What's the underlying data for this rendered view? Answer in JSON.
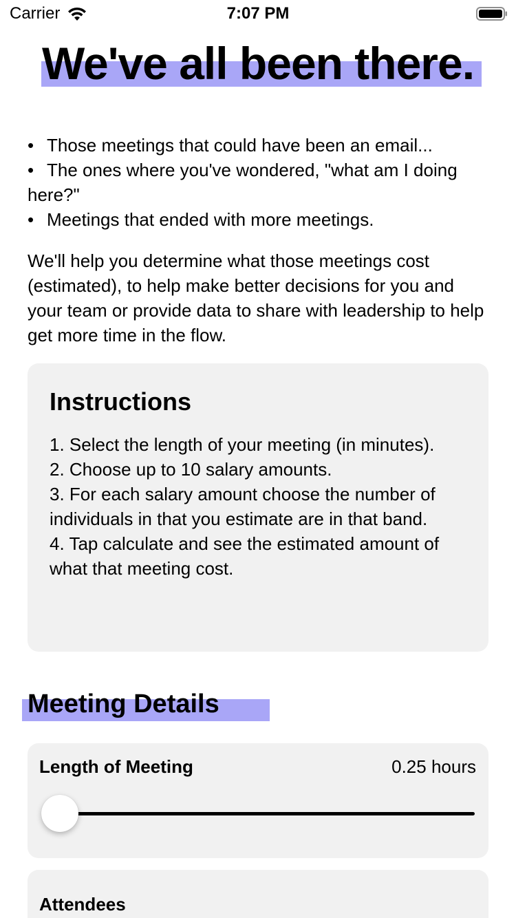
{
  "status_bar": {
    "carrier": "Carrier",
    "time": "7:07 PM",
    "icons": [
      "wifi-icon",
      "battery-icon"
    ]
  },
  "hero": {
    "title": "We've all been there.",
    "highlight_color": "#a9a6f7"
  },
  "bullets": [
    "Those meetings that could have been an email...",
    "The ones where you've wondered, \"what am I doing here?\"",
    "Meetings that ended with more meetings."
  ],
  "intro": "We'll help you determine what those meetings cost (estimated), to help make better decisions for you and your team or provide data to share with leadership to help get more time in the flow.",
  "instructions": {
    "title": "Instructions",
    "steps": [
      "1. Select the length of your meeting (in minutes).",
      "2. Choose up to 10 salary amounts.",
      "3. For each salary amount choose the number of individuals in that you estimate are in that band.",
      "4. Tap calculate and see the estimated amount of what that meeting cost."
    ]
  },
  "meeting_details": {
    "title": "Meeting Details",
    "length": {
      "label": "Length of Meeting",
      "value": "0.25 hours",
      "slider_fraction": 0.0
    },
    "attendees": {
      "label": "Attendees"
    }
  },
  "colors": {
    "card_background": "#f1f1f1",
    "highlight": "#a9a6f7"
  }
}
